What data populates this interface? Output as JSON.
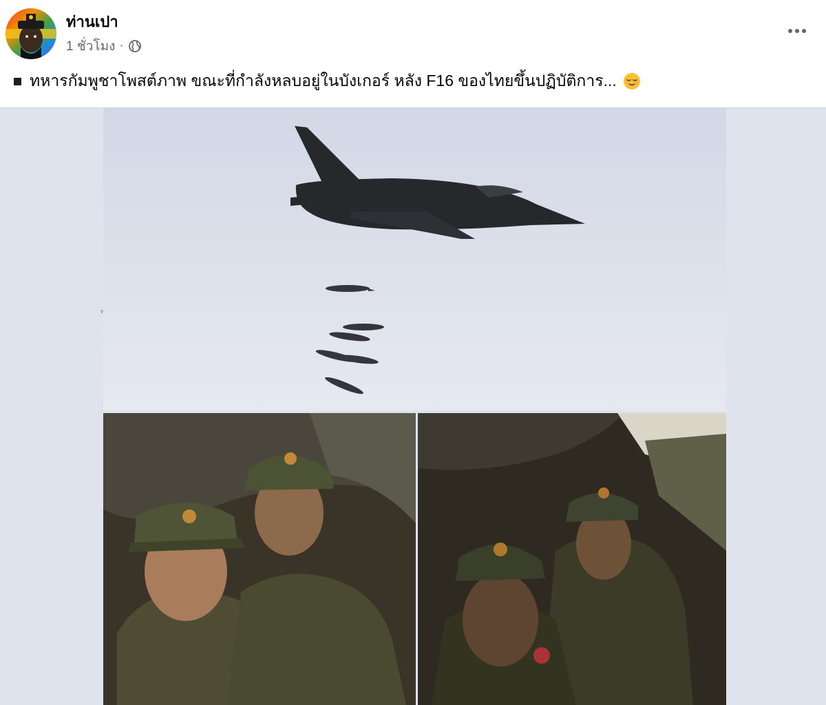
{
  "post": {
    "author": "ท่านเปา",
    "time": "1 ชั่วโมง",
    "separator": "·",
    "privacy_icon": "globe-icon",
    "more_icon": "more-options-icon",
    "caption": "ทหารกัมพูชาโพสต์ภาพ ขณะที่กำลังหลบอยู่ในบังเกอร์ หลัง F16 ของไทยขึ้นปฏิบัติการ...",
    "caption_emoji": "relieved-face-emoji"
  },
  "media": {
    "photos": [
      {
        "subject": "fighter-jet-dropping-bombs"
      },
      {
        "subject": "soldiers-selfie-in-bunker"
      },
      {
        "subject": "soldiers-in-bunker-dark"
      }
    ],
    "tiny_label": "ทหน"
  },
  "colors": {
    "text": "#050505",
    "meta": "#65676b",
    "media_bg": "#dfe3ee"
  }
}
